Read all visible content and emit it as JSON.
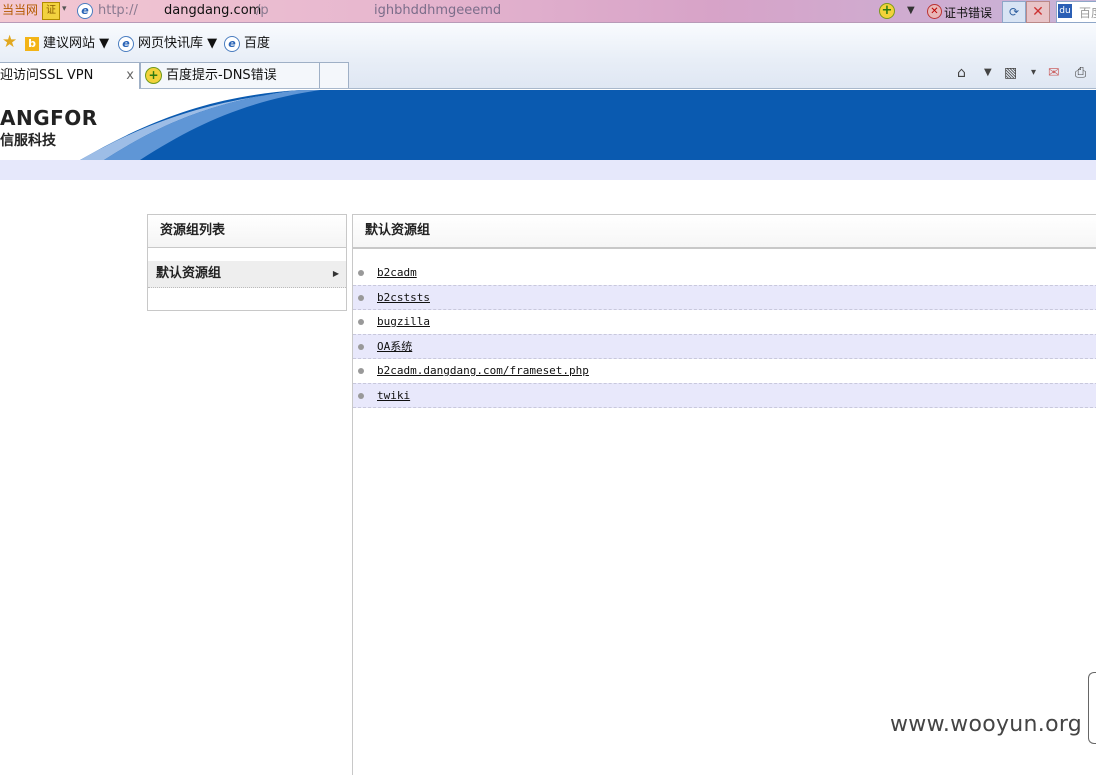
{
  "browser": {
    "site_badge": "当当网",
    "cert_mini": "证",
    "url": {
      "part1": "http://",
      "part2": "dangdang.com",
      "part3": "/p",
      "part4": "ighbhddhmgeeemd"
    },
    "cert_error_label": "证书错误",
    "search_text": "百度",
    "favorites": [
      {
        "label": "建议网站 ▼",
        "icon": "bing-icon"
      },
      {
        "label": "网页快讯库 ▼",
        "icon": "ie-icon"
      },
      {
        "label": "百度",
        "icon": "ie-icon"
      }
    ],
    "tabs": [
      {
        "label": "迎访问SSL VPN",
        "close": "x"
      },
      {
        "label": "百度提示-DNS错误"
      }
    ]
  },
  "header": {
    "brand": "ANGFOR",
    "brand_cn": "信服科技",
    "colors": {
      "banner_blue": "#0a5ab0",
      "subbar": "#e6e8fb"
    }
  },
  "left_panel": {
    "title": "资源组列表",
    "items": [
      {
        "label": "默认资源组"
      }
    ]
  },
  "right_panel": {
    "title": "默认资源组",
    "resources": [
      {
        "label": "b2cadm"
      },
      {
        "label": "b2cststs"
      },
      {
        "label": "bugzilla"
      },
      {
        "label": "OA系统"
      },
      {
        "label": "b2cadm.dangdang.com/frameset.php"
      },
      {
        "label": "twiki"
      }
    ]
  },
  "watermark": "www.wooyun.org"
}
